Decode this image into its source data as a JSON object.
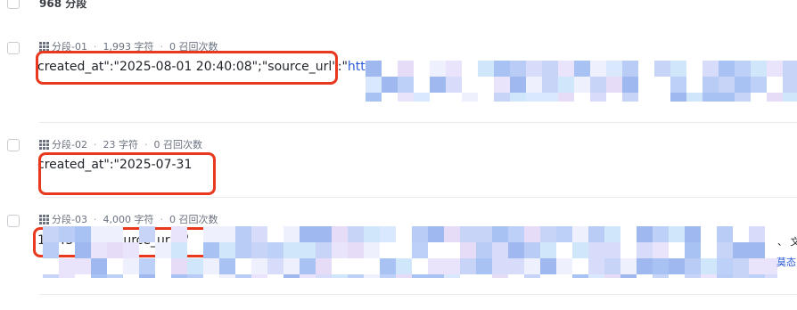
{
  "header": {
    "title": "968 分段"
  },
  "segments": [
    {
      "label": "分段-01",
      "chars": "1,993 字符",
      "recalls": "0 召回次数",
      "text": "created_at\":\"2025-08-01 20:40:08\";\"source_url\":\"",
      "link_text": "http"
    },
    {
      "label": "分段-02",
      "chars": "23 字符",
      "recalls": "0 召回次数",
      "text": "created_at\":\"2025-07-31"
    },
    {
      "label": "分段-03",
      "chars": "4,000 字符",
      "recalls": "0 召回次数",
      "text": "18:45:34\";\"source_url\":\"",
      "side_text_1": "、 文",
      "side_text_2": "莫态"
    }
  ],
  "colors": {
    "highlight_box": "#e8391e",
    "link": "#2b5cd9",
    "meta_text": "#6b7280",
    "divider": "#e8eaed"
  },
  "icons": {
    "segment_icon": "grid-icon"
  }
}
